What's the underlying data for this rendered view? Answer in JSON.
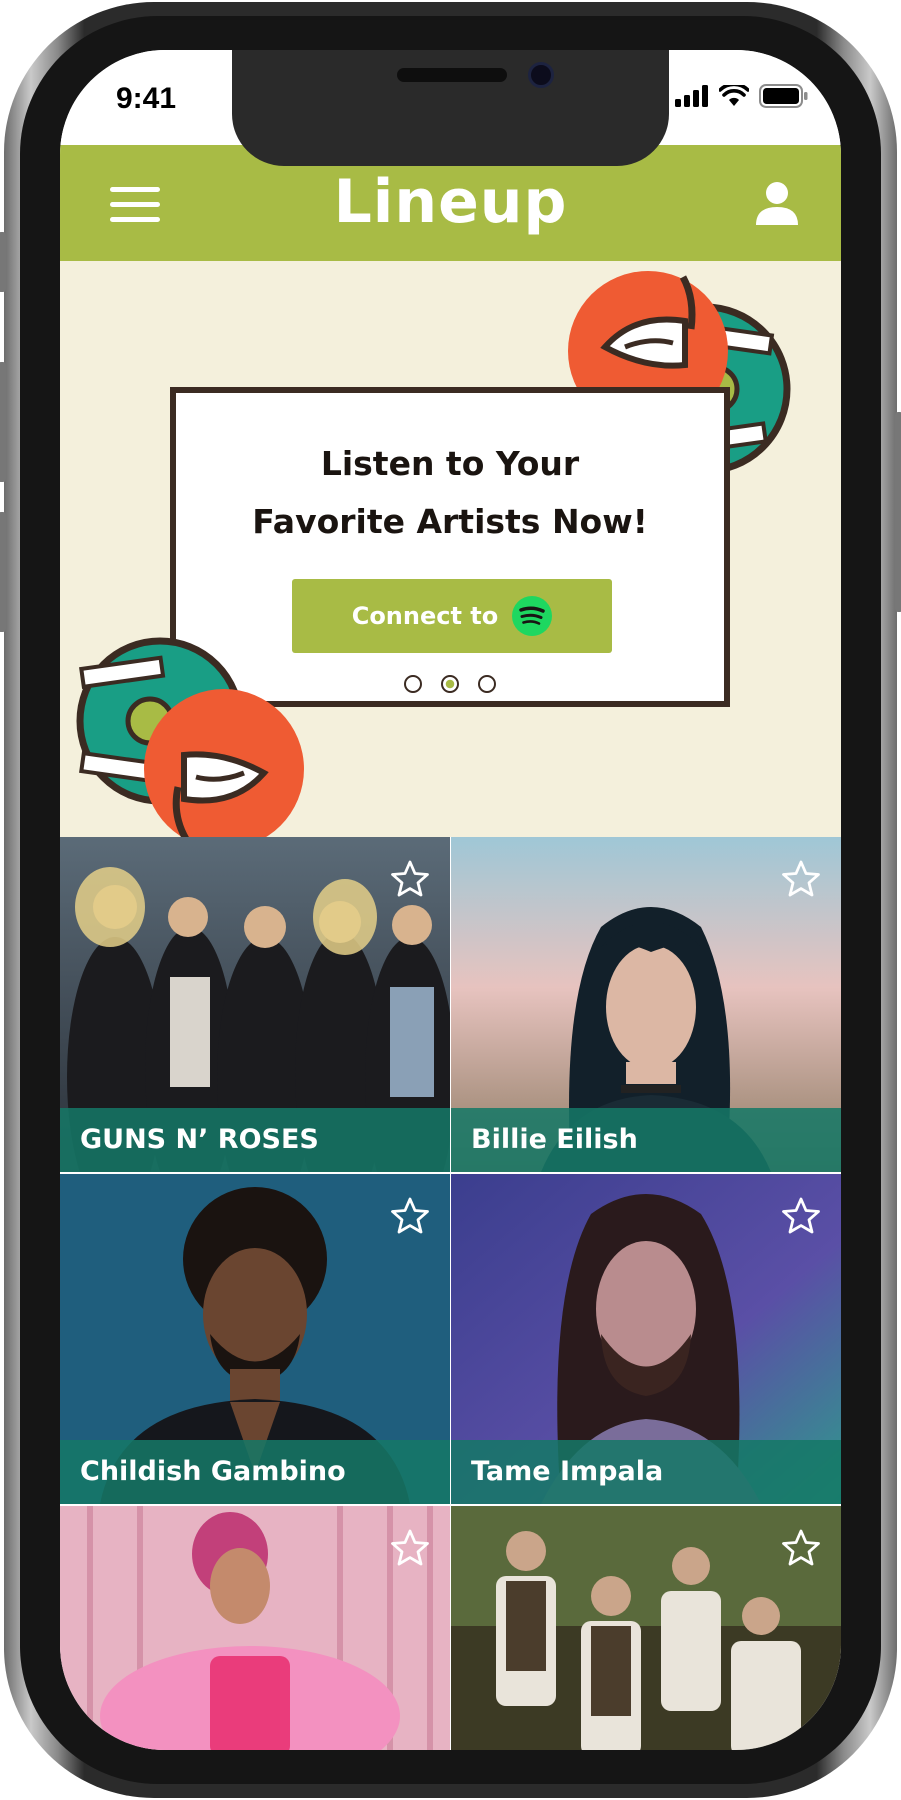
{
  "status_bar": {
    "time": "9:41"
  },
  "header": {
    "title": "Lineup",
    "menu_icon": "hamburger-menu-icon",
    "profile_icon": "user-icon",
    "color": "#a8bb45"
  },
  "promo": {
    "title_line1": "Listen to Your",
    "title_line2": "Favorite Artists Now!",
    "connect_label": "Connect to",
    "service_icon": "spotify-icon",
    "carousel": {
      "count": 3,
      "active_index": 2
    },
    "background": "#f4f0dc"
  },
  "artists": [
    {
      "name": "GUNS N’ ROSES",
      "favorite_icon": "star-outline-icon"
    },
    {
      "name": "Billie Eilish",
      "favorite_icon": "star-outline-icon"
    },
    {
      "name": "Childish Gambino",
      "favorite_icon": "star-outline-icon"
    },
    {
      "name": "Tame Impala",
      "favorite_icon": "star-outline-icon"
    },
    {
      "name": "",
      "favorite_icon": "star-outline-icon"
    },
    {
      "name": "",
      "favorite_icon": "star-outline-icon"
    }
  ],
  "colors": {
    "accent": "#a8bb45",
    "label_overlay": "#157866",
    "deco_orange": "#ef5b33",
    "deco_teal": "#199e85",
    "outline": "#3b2b22"
  }
}
